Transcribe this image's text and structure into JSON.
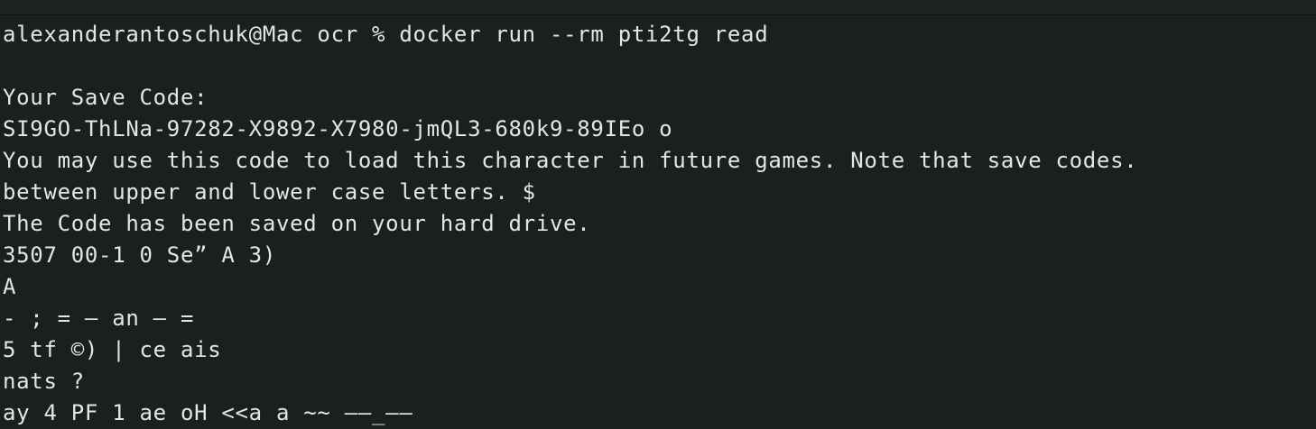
{
  "terminal": {
    "lines": [
      "alexanderantoschuk@Mac ocr % docker run --rm pti2tg read",
      "",
      "Your Save Code:",
      "SI9GO-ThLNa-97282-X9892-X7980-jmQL3-680k9-89IEo o",
      "You may use this code to load this character in future games. Note that save codes.",
      "between upper and lower case letters. $",
      "The Code has been saved on your hard drive.",
      "3507 00-1 0 Se” A 3)",
      "A",
      "- ; = — an — =",
      "5 tf ©) | ce ais",
      "nats ?",
      "ay 4 PF 1 ae oH <<a a ~~ ——_——"
    ]
  }
}
